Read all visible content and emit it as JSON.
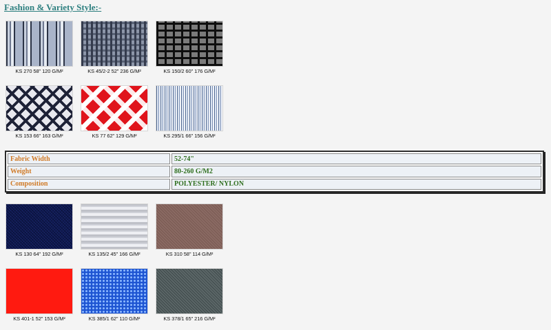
{
  "title": "Fashion & Variety Style:-",
  "group1": [
    {
      "caption": "KS 270   58\"  120 G/M²",
      "pattern": "striped-grey"
    },
    {
      "caption": "KS 45/2-2  52\"  236 G/M²",
      "pattern": "mesh-grey"
    },
    {
      "caption": "KS 150/2  60\"  176 G/M²",
      "pattern": "black-grid"
    },
    {
      "caption": "KS 153   66\"  163 G/M²",
      "pattern": "navy-plaid"
    },
    {
      "caption": "KS 77   62\"  129 G/M²",
      "pattern": "red-white-check"
    },
    {
      "caption": "KS 295/1  66\"  156 G/M²",
      "pattern": "pinstripe-blue"
    }
  ],
  "spec": [
    {
      "label": "Fabric Width",
      "value": "52-74\""
    },
    {
      "label": "Weight",
      "value": "80-260 G/M2"
    },
    {
      "label": "Composition",
      "value": "POLYESTER/ NYLON"
    }
  ],
  "group2": [
    {
      "caption": "KS 130  64\"  192 G/M²",
      "pattern": "navy-solid-weave"
    },
    {
      "caption": "KS 135/2  45\"  166 G/M²",
      "pattern": "light-grey-stripe"
    },
    {
      "caption": "KS 310  58\"  114 G/M²",
      "pattern": "brown-solid"
    },
    {
      "caption": "KS 401-1  52\"  153 G/M²",
      "pattern": "red-solid"
    },
    {
      "caption": "KS 385/1  62\"  110 G/M²",
      "pattern": "blue-dot-mesh"
    },
    {
      "caption": "KS 378/1  65\"  216 G/M²",
      "pattern": "dark-grey-solid"
    }
  ]
}
